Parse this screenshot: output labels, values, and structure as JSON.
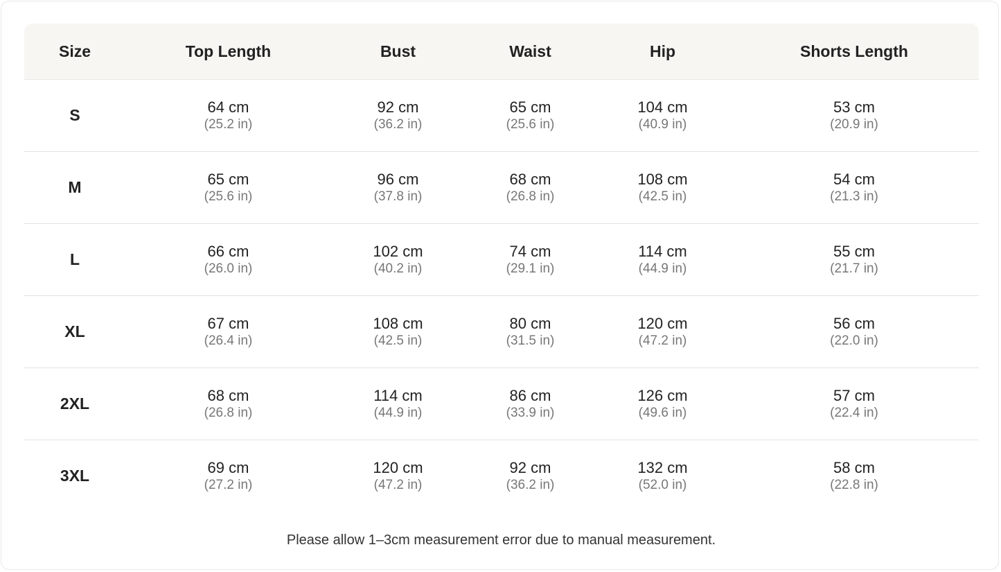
{
  "table": {
    "headers": [
      "Size",
      "Top Length",
      "Bust",
      "Waist",
      "Hip",
      "Shorts Length"
    ],
    "rows": [
      {
        "size": "S",
        "cells": [
          [
            "64 cm",
            "(25.2 in)"
          ],
          [
            "92 cm",
            "(36.2 in)"
          ],
          [
            "65 cm",
            "(25.6 in)"
          ],
          [
            "104 cm",
            "(40.9 in)"
          ],
          [
            "53 cm",
            "(20.9 in)"
          ]
        ]
      },
      {
        "size": "M",
        "cells": [
          [
            "65 cm",
            "(25.6 in)"
          ],
          [
            "96 cm",
            "(37.8 in)"
          ],
          [
            "68 cm",
            "(26.8 in)"
          ],
          [
            "108 cm",
            "(42.5 in)"
          ],
          [
            "54 cm",
            "(21.3 in)"
          ]
        ]
      },
      {
        "size": "L",
        "cells": [
          [
            "66 cm",
            "(26.0 in)"
          ],
          [
            "102 cm",
            "(40.2 in)"
          ],
          [
            "74 cm",
            "(29.1 in)"
          ],
          [
            "114 cm",
            "(44.9 in)"
          ],
          [
            "55 cm",
            "(21.7 in)"
          ]
        ]
      },
      {
        "size": "XL",
        "cells": [
          [
            "67 cm",
            "(26.4 in)"
          ],
          [
            "108 cm",
            "(42.5 in)"
          ],
          [
            "80 cm",
            "(31.5 in)"
          ],
          [
            "120 cm",
            "(47.2 in)"
          ],
          [
            "56 cm",
            "(22.0 in)"
          ]
        ]
      },
      {
        "size": "2XL",
        "cells": [
          [
            "68 cm",
            "(26.8 in)"
          ],
          [
            "114 cm",
            "(44.9 in)"
          ],
          [
            "86 cm",
            "(33.9 in)"
          ],
          [
            "126 cm",
            "(49.6 in)"
          ],
          [
            "57 cm",
            "(22.4 in)"
          ]
        ]
      },
      {
        "size": "3XL",
        "cells": [
          [
            "69 cm",
            "(27.2 in)"
          ],
          [
            "120 cm",
            "(47.2 in)"
          ],
          [
            "92 cm",
            "(36.2 in)"
          ],
          [
            "132 cm",
            "(52.0 in)"
          ],
          [
            "58 cm",
            "(22.8 in)"
          ]
        ]
      }
    ]
  },
  "footer": {
    "note": "Please allow 1–3cm measurement error due to manual measurement."
  },
  "colors": {
    "header_bg": "#f7f6f3",
    "text_primary": "#222222",
    "text_secondary": "#777777",
    "divider": "#e3e3e3"
  }
}
